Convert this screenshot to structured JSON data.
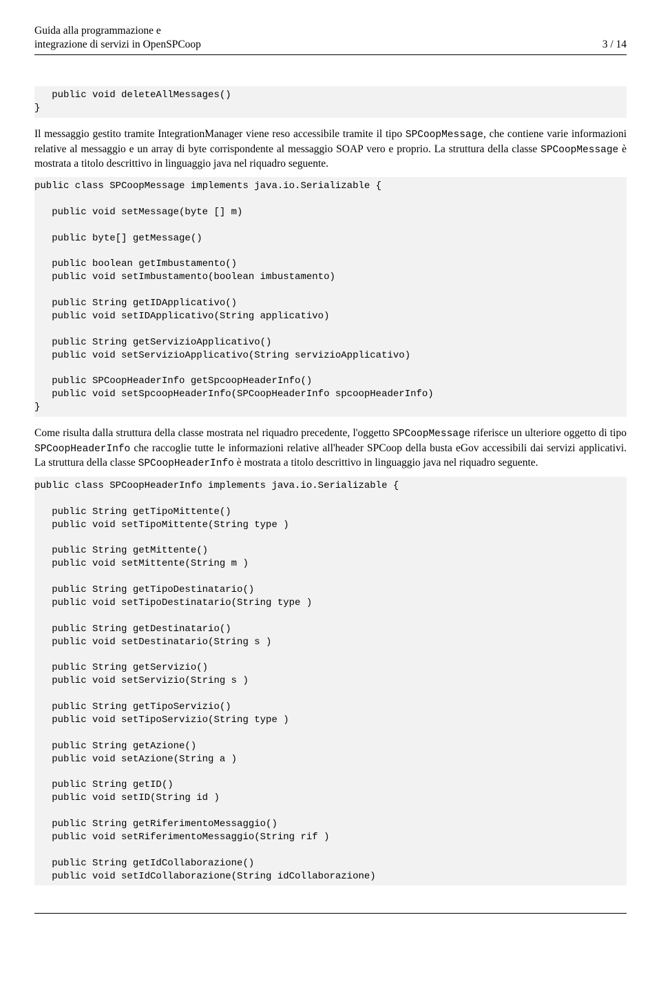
{
  "header": {
    "title_line1": "Guida alla programmazione e",
    "title_line2": "integrazione di servizi in OpenSPCoop",
    "page_indicator": "3 / 14"
  },
  "code1": "   public void deleteAllMessages()\n}",
  "para1_pre": "Il messaggio gestito tramite IntegrationManager viene reso accessibile tramite il tipo ",
  "para1_code1": "SPCoopMessage",
  "para1_mid": ", che contiene varie informazioni relative al messaggio e un array di byte corrispondente al messaggio SOAP vero e proprio. La struttura della classe ",
  "para1_code2": "SPCoopMessage",
  "para1_post": " è mostrata a titolo descrittivo in linguaggio java nel riquadro seguente.",
  "code2": "public class SPCoopMessage implements java.io.Serializable {\n\n   public void setMessage(byte [] m)\n\n   public byte[] getMessage()\n\n   public boolean getImbustamento()\n   public void setImbustamento(boolean imbustamento)\n\n   public String getIDApplicativo()\n   public void setIDApplicativo(String applicativo)\n\n   public String getServizioApplicativo()\n   public void setServizioApplicativo(String servizioApplicativo)\n\n   public SPCoopHeaderInfo getSpcoopHeaderInfo()\n   public void setSpcoopHeaderInfo(SPCoopHeaderInfo spcoopHeaderInfo)\n}",
  "para2_pre": "Come risulta dalla struttura della classe mostrata nel riquadro precedente, l'oggetto ",
  "para2_code1": "SPCoopMessage",
  "para2_mid1": " riferisce un ulteriore oggetto di tipo ",
  "para2_code2": "SPCoopHeaderInfo",
  "para2_mid2": " che raccoglie tutte le informazioni relative all'header SPCoop della busta eGov accessibili dai servizi applicativi. La struttura della classe ",
  "para2_code3": "SPCoopHeaderInfo",
  "para2_post": " è mostrata a titolo descrittivo in linguaggio java nel riquadro seguente.",
  "code3": "public class SPCoopHeaderInfo implements java.io.Serializable {\n\n   public String getTipoMittente()\n   public void setTipoMittente(String type )\n\n   public String getMittente()\n   public void setMittente(String m )\n\n   public String getTipoDestinatario()\n   public void setTipoDestinatario(String type )\n\n   public String getDestinatario()\n   public void setDestinatario(String s )\n\n   public String getServizio()\n   public void setServizio(String s )\n\n   public String getTipoServizio()\n   public void setTipoServizio(String type )\n\n   public String getAzione()\n   public void setAzione(String a )\n\n   public String getID()\n   public void setID(String id )\n\n   public String getRiferimentoMessaggio()\n   public void setRiferimentoMessaggio(String rif )\n\n   public String getIdCollaborazione()\n   public void setIdCollaborazione(String idCollaborazione)"
}
